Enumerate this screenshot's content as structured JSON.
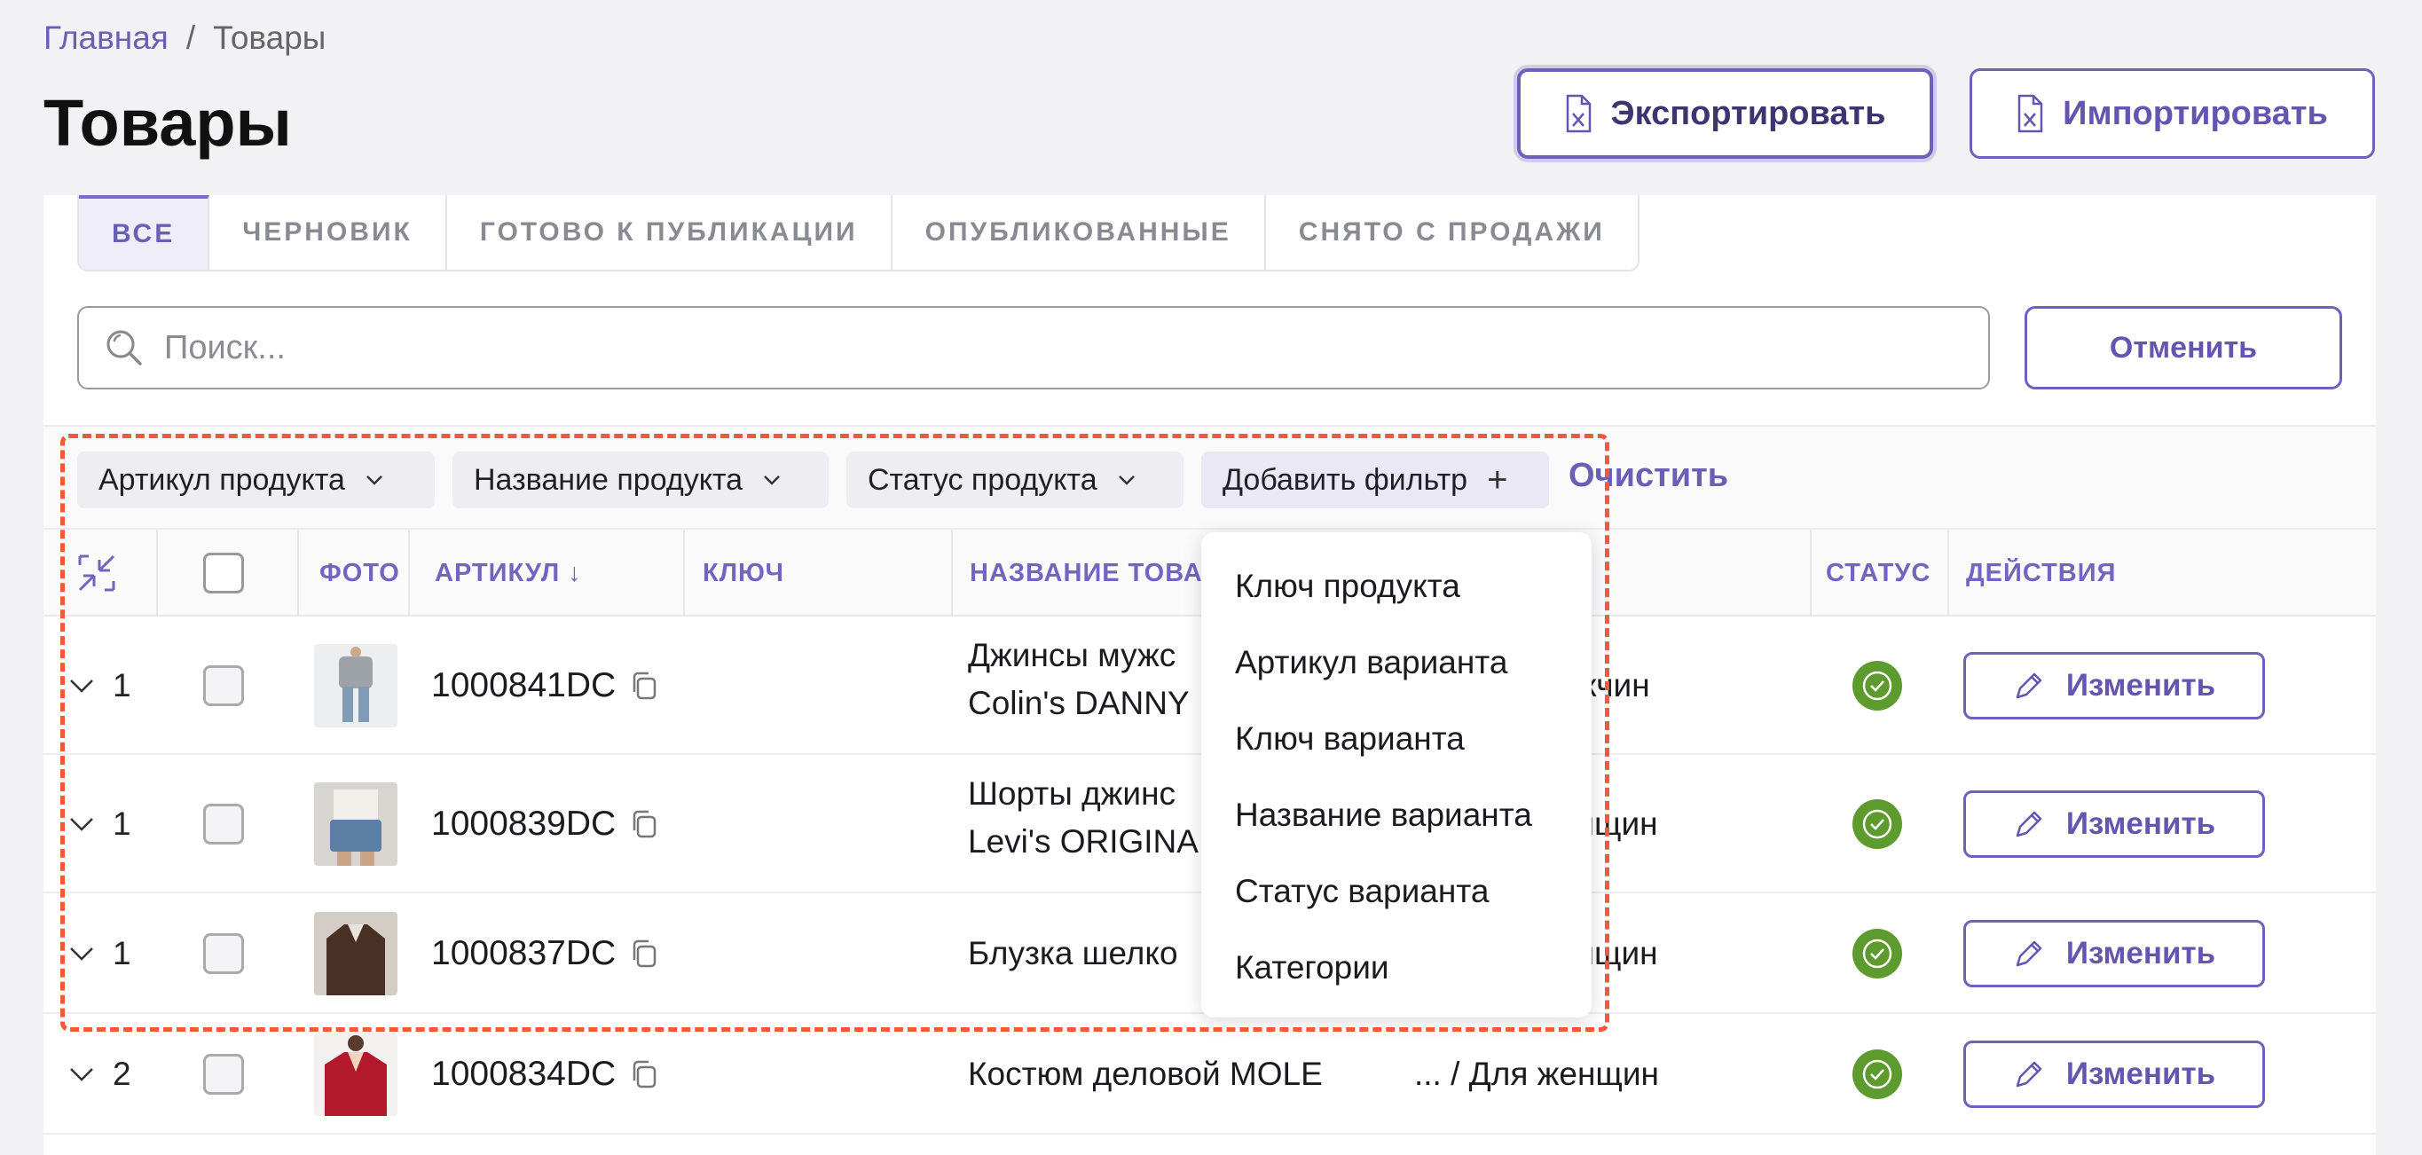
{
  "breadcrumb": {
    "home": "Главная",
    "separator": "/",
    "current": "Товары"
  },
  "page": {
    "title": "Товары"
  },
  "actions": {
    "export_label": "Экспортировать",
    "import_label": "Импортировать",
    "icon": "excel-file-icon"
  },
  "tabs": [
    {
      "label": "ВСЕ",
      "active": true
    },
    {
      "label": "ЧЕРНОВИК",
      "active": false
    },
    {
      "label": "ГОТОВО К ПУБЛИКАЦИИ",
      "active": false
    },
    {
      "label": "ОПУБЛИКОВАННЫЕ",
      "active": false
    },
    {
      "label": "СНЯТО С ПРОДАЖИ",
      "active": false
    }
  ],
  "search": {
    "placeholder": "Поиск...",
    "value": "",
    "cancel_label": "Отменить"
  },
  "filters": {
    "chips": [
      "Артикул продукта",
      "Название продукта",
      "Статус продукта",
      "Добавить фильтр"
    ],
    "add_icon": "+",
    "clear_label": "Очистить"
  },
  "table": {
    "headers": {
      "photo": "ФОТО",
      "sku": "АРТИКУЛ ↓",
      "key": "КЛЮЧ",
      "name": "НАЗВАНИЕ ТОВАР",
      "status": "СТАТУС",
      "actions": "ДЕЙСТВИЯ"
    },
    "edit_label": "Изменить",
    "rows": [
      {
        "count": "1",
        "sku": "1000841DC",
        "name_line1": "Джинсы мужс",
        "name_line2": "Colin's DANNY",
        "category": "ужчин",
        "status": "published"
      },
      {
        "count": "1",
        "sku": "1000839DC",
        "name_line1": "Шорты джинс",
        "name_line2": "Levi's ORIGINA",
        "category": "енщин",
        "status": "published"
      },
      {
        "count": "1",
        "sku": "1000837DC",
        "name_line1": "Блузка шелко",
        "name_line2": "",
        "category": "енщин",
        "status": "published"
      },
      {
        "count": "2",
        "sku": "1000834DC",
        "name_line1": "Костюм деловой MOLE",
        "name_line2": "",
        "category": "... / Для женщин",
        "status": "published"
      }
    ]
  },
  "filter_dropdown": {
    "items": [
      "Ключ продукта",
      "Артикул варианта",
      "Ключ варианта",
      "Название варианта",
      "Статус варианта",
      "Категории"
    ]
  },
  "colors": {
    "accent": "#6b5fb3",
    "status_green": "#5e9b2f",
    "highlight": "#f05a3a"
  }
}
